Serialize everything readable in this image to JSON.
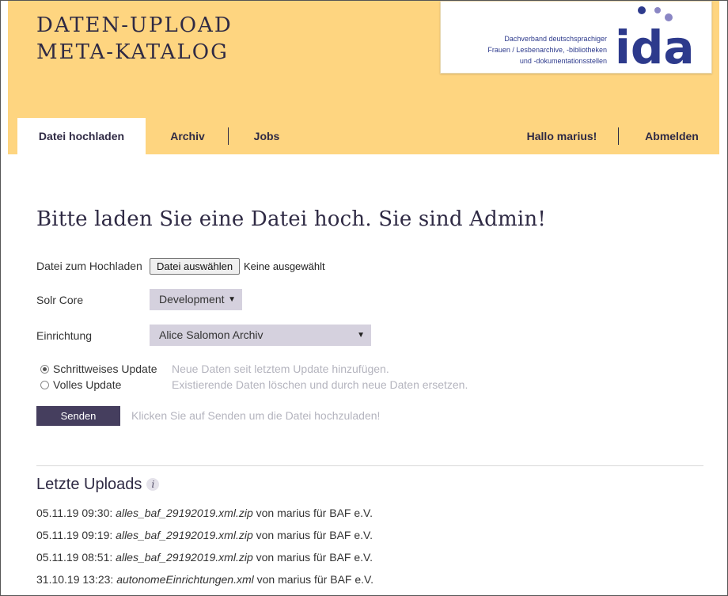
{
  "header": {
    "title_line1": "DATEN-UPLOAD",
    "title_line2": "META-KATALOG",
    "logo": {
      "tagline_line1": "Dachverband deutschsprachiger",
      "tagline_line2": "Frauen / Lesbenarchive, -bibliotheken",
      "tagline_line3": "und -dokumentationsstellen",
      "mark": "ida",
      "brand_color": "#2d3a8c",
      "dot_color": "#8a86c4"
    },
    "background": "#fed580"
  },
  "nav": {
    "tabs": [
      {
        "label": "Datei hochladen",
        "active": true
      },
      {
        "label": "Archiv",
        "active": false
      },
      {
        "label": "Jobs",
        "active": false
      }
    ],
    "greeting": "Hallo marius!",
    "logout": "Abmelden"
  },
  "main": {
    "heading": "Bitte laden Sie eine Datei hoch. Sie sind Admin!",
    "file": {
      "label": "Datei zum Hochladen",
      "button": "Datei auswählen",
      "status": "Keine ausgewählt"
    },
    "solr": {
      "label": "Solr Core",
      "selected": "Development"
    },
    "einrichtung": {
      "label": "Einrichtung",
      "selected": "Alice Salomon Archiv"
    },
    "update_options": [
      {
        "label": "Schrittweises Update",
        "hint": "Neue Daten seit letztem Update hinzufügen.",
        "checked": true
      },
      {
        "label": "Volles Update",
        "hint": "Existierende Daten löschen und durch neue Daten ersetzen.",
        "checked": false
      }
    ],
    "send": {
      "label": "Senden",
      "hint": "Klicken Sie auf Senden um die Datei hochzuladen!"
    }
  },
  "uploads": {
    "heading": "Letzte Uploads",
    "info_icon": "info-icon",
    "items": [
      {
        "time": "05.11.19 09:30:",
        "file": "alles_baf_29192019.xml.zip",
        "rest": "von marius für BAF e.V."
      },
      {
        "time": "05.11.19 09:19:",
        "file": "alles_baf_29192019.xml.zip",
        "rest": "von marius für BAF e.V."
      },
      {
        "time": "05.11.19 08:51:",
        "file": "alles_baf_29192019.xml.zip",
        "rest": "von marius für BAF e.V."
      },
      {
        "time": "31.10.19 13:23:",
        "file": "autonomeEinrichtungen.xml",
        "rest": "von marius für BAF e.V."
      }
    ]
  },
  "colors": {
    "accent": "#453e5e",
    "select_bg": "#d5d1de",
    "hint": "#b4b4be"
  }
}
